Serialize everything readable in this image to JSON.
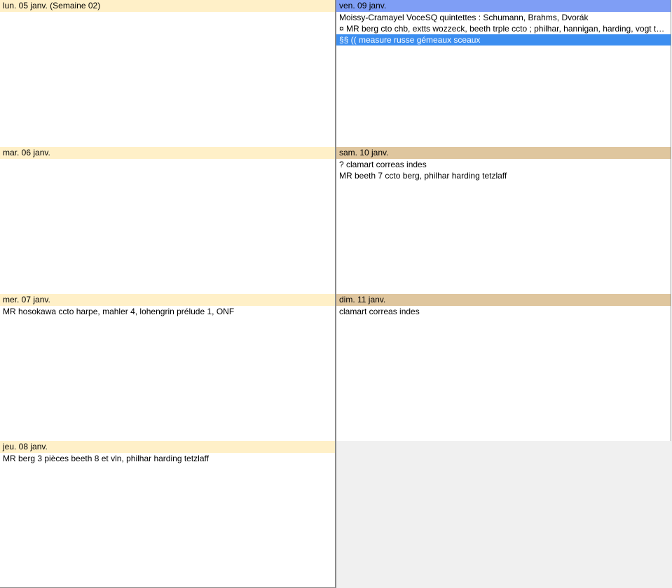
{
  "days": [
    {
      "id": "mon",
      "header": "lun. 05 janv. (Semaine 02)",
      "events": []
    },
    {
      "id": "tue",
      "header": "mar. 06 janv.",
      "events": []
    },
    {
      "id": "wed",
      "header": "mer. 07 janv.",
      "events": [
        "MR hosokawa ccto harpe, mahler 4, lohengrin prélude 1, ONF"
      ]
    },
    {
      "id": "thu",
      "header": "jeu. 08 janv.",
      "events": [
        "MR berg 3 pièces beeth 8 et vln, philhar harding tetzlaff"
      ]
    },
    {
      "id": "fri",
      "header": "ven. 09 janv.",
      "events": [
        "Moissy-Cramayel VoceSQ quintettes : Schumann, Brahms, Dvorák",
        "¤ MR berg cto chb, extts wozzeck, beeth trple ccto ; philhar, hannigan, harding, vogt tetzlaff",
        "§§ (( measure russe gémeaux sceaux"
      ]
    },
    {
      "id": "sat",
      "header": "sam. 10 janv.",
      "events": [
        "? clamart correas indes",
        "MR beeth 7 ccto berg, philhar harding tetzlaff"
      ]
    },
    {
      "id": "sun",
      "header": "dim. 11 janv.",
      "events": [
        "clamart correas indes"
      ]
    }
  ],
  "colors": {
    "weekday_header": "#fff0c8",
    "weekend_header": "#dfc69e",
    "today_header": "#7f9ef5",
    "selected_event": "#3c8ef0",
    "empty_cell": "#f0f0f0"
  }
}
